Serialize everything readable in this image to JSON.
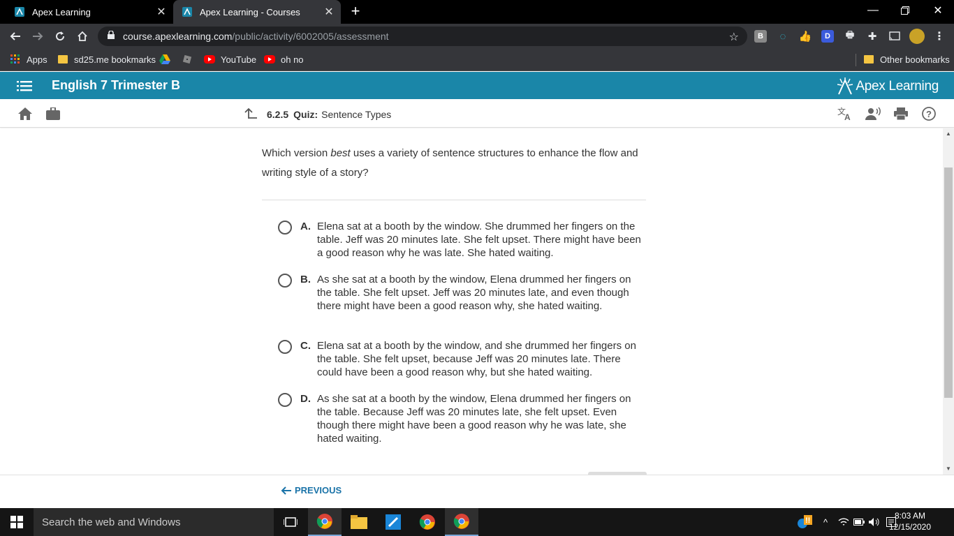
{
  "browser": {
    "tabs": [
      {
        "title": "Apex Learning",
        "active": false
      },
      {
        "title": "Apex Learning - Courses",
        "active": true
      }
    ],
    "url_host": "course.apexlearning.com",
    "url_path": "/public/activity/6002005/assessment",
    "bookmarks": [
      {
        "label": "Apps",
        "icon": "apps-grid-icon"
      },
      {
        "label": "sd25.me bookmarks",
        "icon": "folder-icon"
      },
      {
        "label": "",
        "icon": "google-drive-icon"
      },
      {
        "label": "",
        "icon": "roblox-icon"
      },
      {
        "label": "YouTube",
        "icon": "youtube-icon"
      },
      {
        "label": "oh no",
        "icon": "youtube-icon"
      }
    ],
    "other_bookmarks": "Other bookmarks",
    "extensions": [
      "B",
      "",
      "",
      "D"
    ]
  },
  "course": {
    "title": "English 7 Trimester B",
    "logo_text": "Apex Learning"
  },
  "activity": {
    "number": "6.2.5",
    "type": "Quiz:",
    "name": "Sentence Types"
  },
  "question": {
    "prompt_before": "Which version ",
    "prompt_emphasis": "best",
    "prompt_after": " uses a variety of sentence structures to enhance the flow and writing style of a story?",
    "choices": [
      {
        "letter": "A.",
        "text": "Elena sat at a booth by the window. She drummed her fingers on the table. Jeff was 20 minutes late. She felt upset. There might have been a good reason why he was late. She hated waiting."
      },
      {
        "letter": "B.",
        "text": "As she sat at a booth by the window, Elena drummed her fingers on the table. She felt upset. Jeff was 20 minutes late, and even though there might have been a good reason why, she hated waiting."
      },
      {
        "letter": "C.",
        "text": "Elena sat at a booth by the window, and she drummed her fingers on the table. She felt upset, because Jeff was 20 minutes late. There could have been a good reason why, but she hated waiting."
      },
      {
        "letter": "D.",
        "text": "As she sat at a booth by the window, Elena drummed her fingers on the table. Because Jeff was 20 minutes late, she felt upset. Even though there might have been a good reason why he was late, she hated waiting."
      }
    ]
  },
  "footer": {
    "previous_label": "PREVIOUS"
  },
  "taskbar": {
    "search_placeholder": "Search the web and Windows",
    "time": "8:03 AM",
    "date": "12/15/2020"
  },
  "colors": {
    "apex_teal": "#1a86a8",
    "chrome_dark": "#35363a",
    "link_blue": "#1a73a8"
  }
}
